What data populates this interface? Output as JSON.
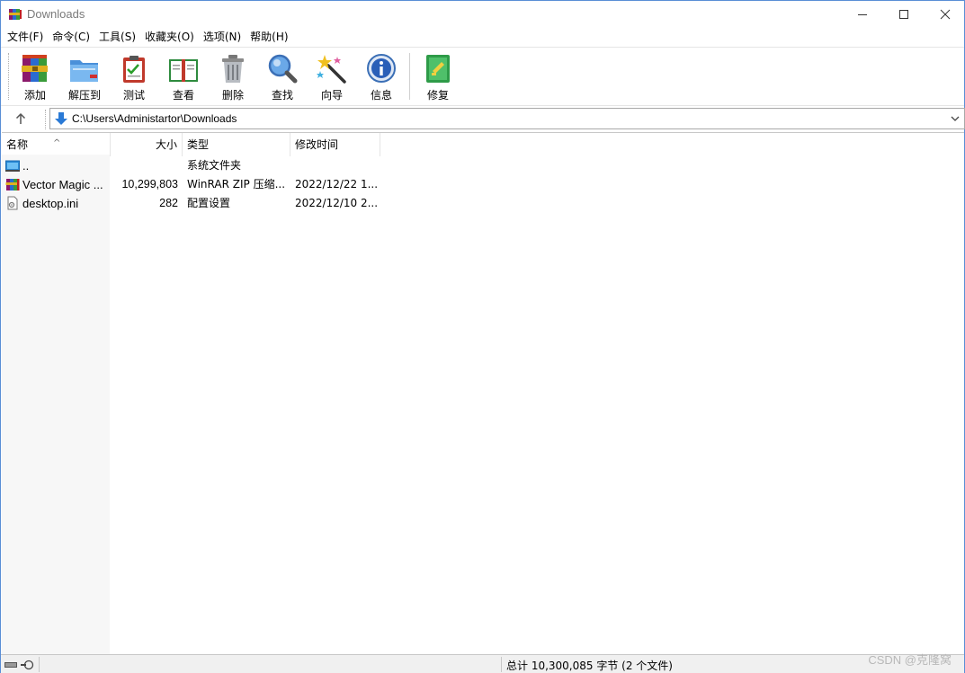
{
  "window": {
    "title": "Downloads"
  },
  "menu": [
    "文件(F)",
    "命令(C)",
    "工具(S)",
    "收藏夹(O)",
    "选项(N)",
    "帮助(H)"
  ],
  "toolbar": {
    "add": "添加",
    "extract": "解压到",
    "test": "测试",
    "view": "查看",
    "delete": "删除",
    "find": "查找",
    "wizard": "向导",
    "info": "信息",
    "repair": "修复"
  },
  "address": {
    "path": "C:\\Users\\Administartor\\Downloads"
  },
  "columns": {
    "name": "名称",
    "size": "大小",
    "type": "类型",
    "modified": "修改时间"
  },
  "files": [
    {
      "name": "..",
      "size": "",
      "type": "系统文件夹",
      "modified": "",
      "icon": "folder-up-icon"
    },
    {
      "name": "Vector Magic ...",
      "size": "10,299,803",
      "type": "WinRAR ZIP 压缩...",
      "modified": "2022/12/22 1...",
      "icon": "winrar-archive-icon"
    },
    {
      "name": "desktop.ini",
      "size": "282",
      "type": "配置设置",
      "modified": "2022/12/10 2...",
      "icon": "settings-file-icon"
    }
  ],
  "status": {
    "summary": "总计 10,300,085 字节 (2 个文件)"
  },
  "watermark": "CSDN @克隆窝"
}
